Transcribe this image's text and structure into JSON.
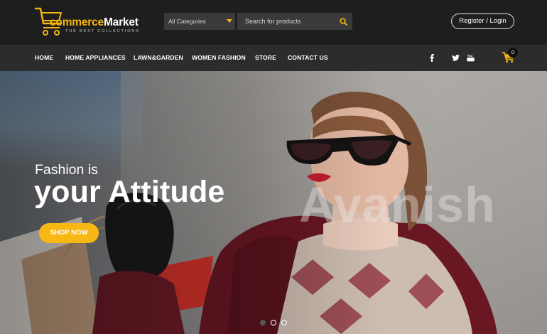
{
  "header": {
    "logo": {
      "name_part1": "commerce",
      "name_part2": "Market",
      "tagline": "THE BEST COLLECTIONS",
      "icon": "shopping-cart-logo"
    },
    "category_select": {
      "selected": "All Categories",
      "icon": "caret-down-icon"
    },
    "search": {
      "placeholder": "Search for products",
      "value": "",
      "icon": "search-icon"
    },
    "login_label": "Register / Login"
  },
  "nav": {
    "items": [
      {
        "label": "HOME"
      },
      {
        "label": "HOME APPLIANCES"
      },
      {
        "label": "LAWN&GARDEN"
      },
      {
        "label": "WOMEN FASHION"
      },
      {
        "label": "STORE"
      },
      {
        "label": "CONTACT US"
      }
    ],
    "social_icons": [
      "facebook-icon",
      "twitter-icon",
      "youtube-icon"
    ],
    "cart": {
      "icon": "cart-icon",
      "count": "0"
    }
  },
  "hero": {
    "subtitle": "Fashion is",
    "title": "your Attitude",
    "watermark": "Avanish",
    "cta_label": "SHOP NOW",
    "slides": {
      "count": 3,
      "active": 1
    }
  },
  "colors": {
    "accent": "#f5b50e",
    "topbar_bg": "#1e1e1e",
    "navbar_bg": "#2c2c2c",
    "cta_bg": "#f7b714"
  }
}
